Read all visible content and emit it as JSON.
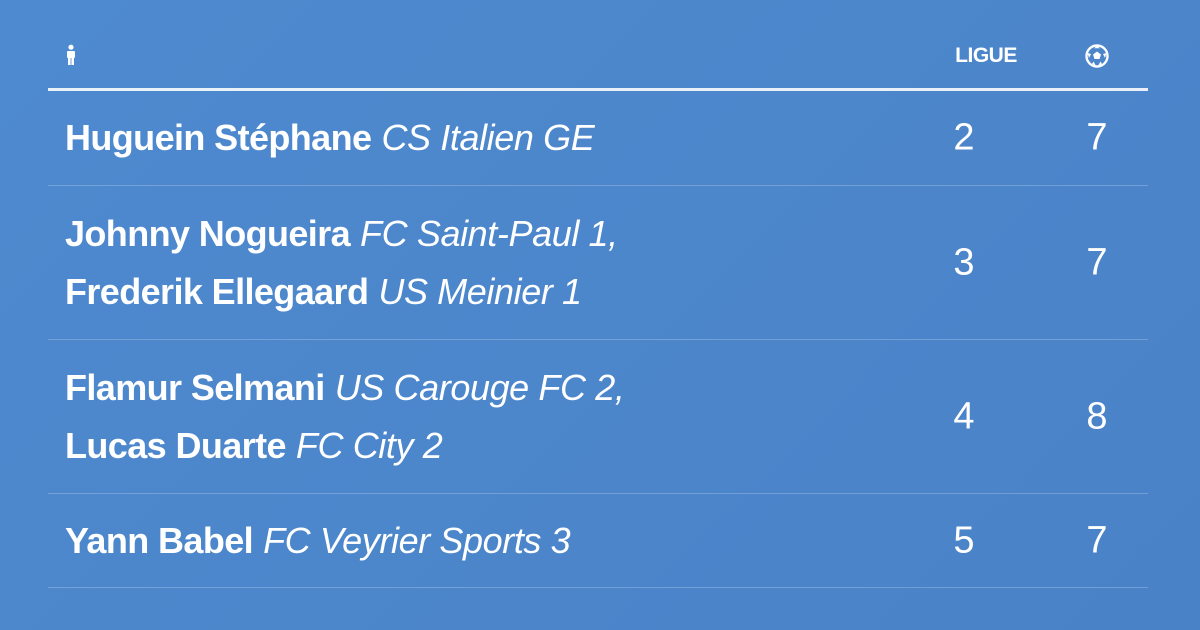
{
  "header": {
    "player_icon": "person-icon",
    "ligue_label": "LIGUE",
    "goals_icon": "soccer-ball-icon"
  },
  "rows": [
    {
      "players": [
        {
          "name": "Huguein Stéphane",
          "club": "CS Italien GE"
        }
      ],
      "ligue": "2",
      "goals": "7"
    },
    {
      "players": [
        {
          "name": "Johnny Nogueira",
          "club": "FC Saint-Paul 1,"
        },
        {
          "name": "Frederik Ellegaard",
          "club": "US Meinier 1"
        }
      ],
      "ligue": "3",
      "goals": "7"
    },
    {
      "players": [
        {
          "name": "Flamur Selmani",
          "club": "US Carouge FC 2,"
        },
        {
          "name": "Lucas Duarte",
          "club": "FC City 2"
        }
      ],
      "ligue": "4",
      "goals": "8"
    },
    {
      "players": [
        {
          "name": "Yann Babel",
          "club": "FC Veyrier Sports 3"
        }
      ],
      "ligue": "5",
      "goals": "7"
    }
  ],
  "colors": {
    "background": "#4c86cb",
    "text": "#ffffff"
  }
}
